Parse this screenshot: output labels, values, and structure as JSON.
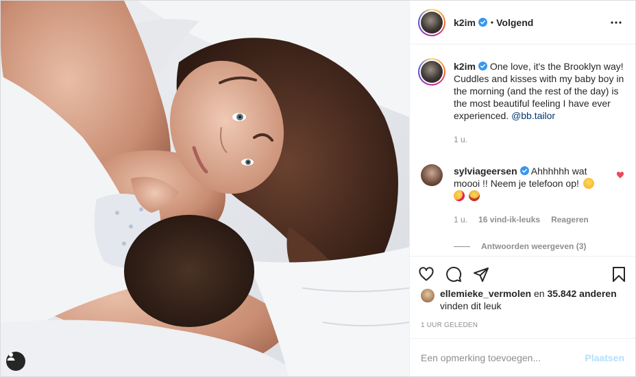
{
  "post": {
    "author": "k2im",
    "follow_state": "Volgend",
    "dot": "•",
    "caption_line1": "One love, it's the Brooklyn way!",
    "caption_line2": "Cuddles and kisses with my baby boy in the morning (and the rest of the day) is the most beautiful feeling I have ever experienced.",
    "caption_mention": "@bb.tailor",
    "caption_age": "1 u."
  },
  "comment": {
    "author": "sylviageersen",
    "text": "Ahhhhhh wat moooi !! Neem je telefoon op!",
    "emojis": [
      "flushed-face",
      "kissing-face-heart",
      "star-struck-face"
    ],
    "age": "1 u.",
    "likes": "16 vind-ik-leuks",
    "reply_label": "Reageren",
    "view_replies": "Antwoorden weergeven (3)"
  },
  "likes": {
    "first_liker": "ellemieke_vermolen",
    "joiner": "en",
    "others": "35.842 anderen",
    "suffix": "vinden dit leuk"
  },
  "timestamp": "1 UUR GELEDEN",
  "add_comment": {
    "placeholder": "Een opmerking toevoegen...",
    "post_label": "Plaatsen"
  },
  "icons": {
    "verified": "verified-badge-icon",
    "more": "more-options-icon",
    "like": "heart-icon",
    "comment": "comment-icon",
    "share": "share-icon",
    "save": "bookmark-icon",
    "tag": "user-tag-icon"
  },
  "colors": {
    "verified": "#3897f0",
    "liked_heart": "#ed4956",
    "mention": "#00376b",
    "post_button_disabled": "#b2dffc",
    "muted_text": "#8e8e8e"
  }
}
